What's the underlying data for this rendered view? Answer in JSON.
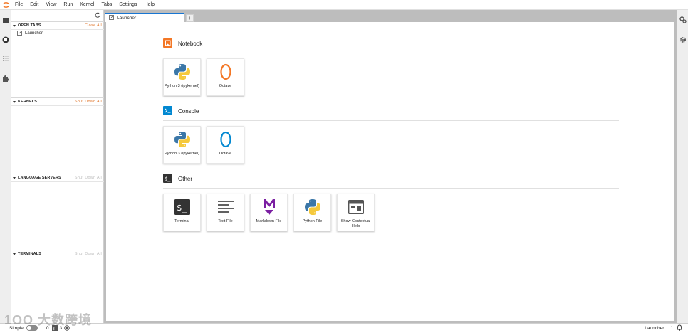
{
  "menu": {
    "items": [
      "File",
      "Edit",
      "View",
      "Run",
      "Kernel",
      "Tabs",
      "Settings",
      "Help"
    ]
  },
  "sidepanel": {
    "open_tabs": {
      "title": "OPEN TABS",
      "action": "Close All",
      "items": [
        "Launcher"
      ]
    },
    "kernels": {
      "title": "KERNELS",
      "action": "Shut Down All"
    },
    "language_servers": {
      "title": "LANGUAGE SERVERS",
      "action": "Shut Down All"
    },
    "terminals": {
      "title": "TERMINALS",
      "action": "Shut Down All"
    }
  },
  "tabs": {
    "active_label": "Launcher",
    "add_label": "+"
  },
  "launcher": {
    "notebook": {
      "title": "Notebook",
      "cards": [
        "Python 3 (ipykernel)",
        "Octave"
      ]
    },
    "console": {
      "title": "Console",
      "cards": [
        "Python 3 (ipykernel)",
        "Octave"
      ]
    },
    "other": {
      "title": "Other",
      "cards": [
        "Terminal",
        "Text File",
        "Markdown File",
        "Python File",
        "Show Contextual Help"
      ]
    }
  },
  "statusbar": {
    "mode": "Simple",
    "count_a": "0",
    "count_b": "3",
    "right_label": "Launcher",
    "right_count": "1"
  },
  "colors": {
    "accent": "#1976d2",
    "action_orange": "#e0752b",
    "notebook_orange": "#f37726",
    "console_blue": "#0288d1",
    "markdown_purple": "#7b1fa2"
  },
  "watermark": "1OO 大数跨境"
}
